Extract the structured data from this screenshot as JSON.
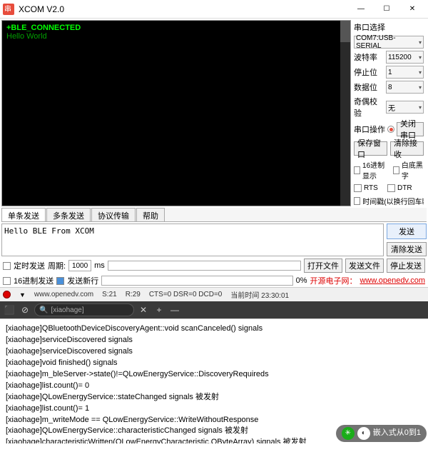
{
  "window": {
    "title": "XCOM V2.0",
    "min": "—",
    "max": "☐",
    "close": "✕"
  },
  "terminal": {
    "line1": "+BLE_CONNECTED",
    "line2": "Hello World"
  },
  "side": {
    "port_label": "串口选择",
    "port_value": "COM7:USB-SERIAL",
    "baud_label": "波特率",
    "baud_value": "115200",
    "stop_label": "停止位",
    "stop_value": "1",
    "data_label": "数据位",
    "data_value": "8",
    "parity_label": "奇偶校验",
    "parity_value": "无",
    "op_label": "串口操作",
    "op_btn": "关闭串口",
    "save_btn": "保存窗口",
    "clear_btn": "清除接收",
    "hex_disp": "16进制显示",
    "white_bg": "白底黑字",
    "rts": "RTS",
    "dtr": "DTR",
    "timestamp": "时间戳(以换行回车断帧)"
  },
  "tabs": {
    "t1": "单条发送",
    "t2": "多条发送",
    "t3": "协议传输",
    "t4": "帮助"
  },
  "send": {
    "text": "Hello BLE From XCOM",
    "send_btn": "发送",
    "clear_btn": "清除发送"
  },
  "opts": {
    "timed": "定时发送",
    "period_label": "周期:",
    "period_value": "1000",
    "ms": "ms",
    "open_file": "打开文件",
    "send_file": "发送文件",
    "stop_send": "停止发送",
    "hex_send": "16进制发送",
    "send_newline": "发送新行",
    "pct": "0%",
    "link_prefix": "开源电子网：",
    "link": "www.openedv.com"
  },
  "status": {
    "url": "www.openedv.com",
    "s": "S:21",
    "r": "R:29",
    "cts": "CTS=0 DSR=0 DCD=0",
    "time_label": "当前时间",
    "time": "23:30:01"
  },
  "toolbar": {
    "search_text": "[xiaohage]",
    "plus": "+",
    "minus": "—"
  },
  "console": {
    "l1": "[xiaohage]QBluetoothDeviceDiscoveryAgent::void scanCanceled() signals",
    "l2": "[xiaohage]serviceDiscovered signals",
    "l3": "[xiaohage]serviceDiscovered signals",
    "l4": "[xiaohage]void finished() signals",
    "l5": "[xiaohage]m_bleServer->state()!=QLowEnergyService::DiscoveryRequireds",
    "l6": "[xiaohage]list.count()= 0",
    "l7": "[xiaohage]QLowEnergyService::stateChanged signals 被发射",
    "l8": "[xiaohage]list.count()= 1",
    "l9": "[xiaohage]m_writeMode == QLowEnergyService::WriteWithoutResponse",
    "l10": "[xiaohage]QLowEnergyService::characteristicChanged signals 被发射",
    "l11": "[xiaohage]characteristicWritten(QLowEnergyCharacteristic,QByteArray) signals 被发射"
  },
  "watermark": {
    "text": "嵌入式从0到1"
  }
}
